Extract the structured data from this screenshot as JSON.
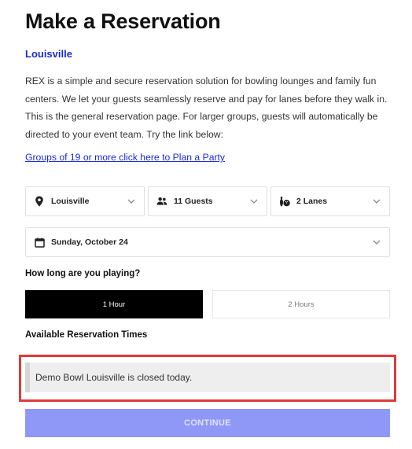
{
  "page": {
    "title": "Make a Reservation",
    "location_link": "Louisville",
    "description": "REX is a simple and secure reservation solution for bowling lounges and family fun centers. We let your guests seamlessly reserve and pay for lanes before they walk in. This is the general reservation page. For larger groups, guests will automatically be directed to your event team. Try the link below:",
    "party_link": "Groups of 19 or more click here to Plan a Party"
  },
  "selects": {
    "location": {
      "value": "Louisville",
      "icon": "map-pin-icon"
    },
    "guests": {
      "value": "11 Guests",
      "icon": "people-icon"
    },
    "lanes": {
      "value": "2 Lanes",
      "icon": "bowling-icon"
    },
    "date": {
      "value": "Sunday, October 24",
      "icon": "calendar-icon"
    }
  },
  "duration": {
    "label": "How long are you playing?",
    "options": [
      "1 Hour",
      "2 Hours"
    ],
    "selected": "1 Hour"
  },
  "times": {
    "label": "Available Reservation Times",
    "notice": "Demo Bowl Louisville is closed today."
  },
  "actions": {
    "continue_label": "CONTINUE"
  },
  "colors": {
    "link": "#1a2bd6",
    "selected_duration_bg": "#000000",
    "continue_bg": "#8f98f7",
    "highlight_border": "#e03a3a"
  }
}
